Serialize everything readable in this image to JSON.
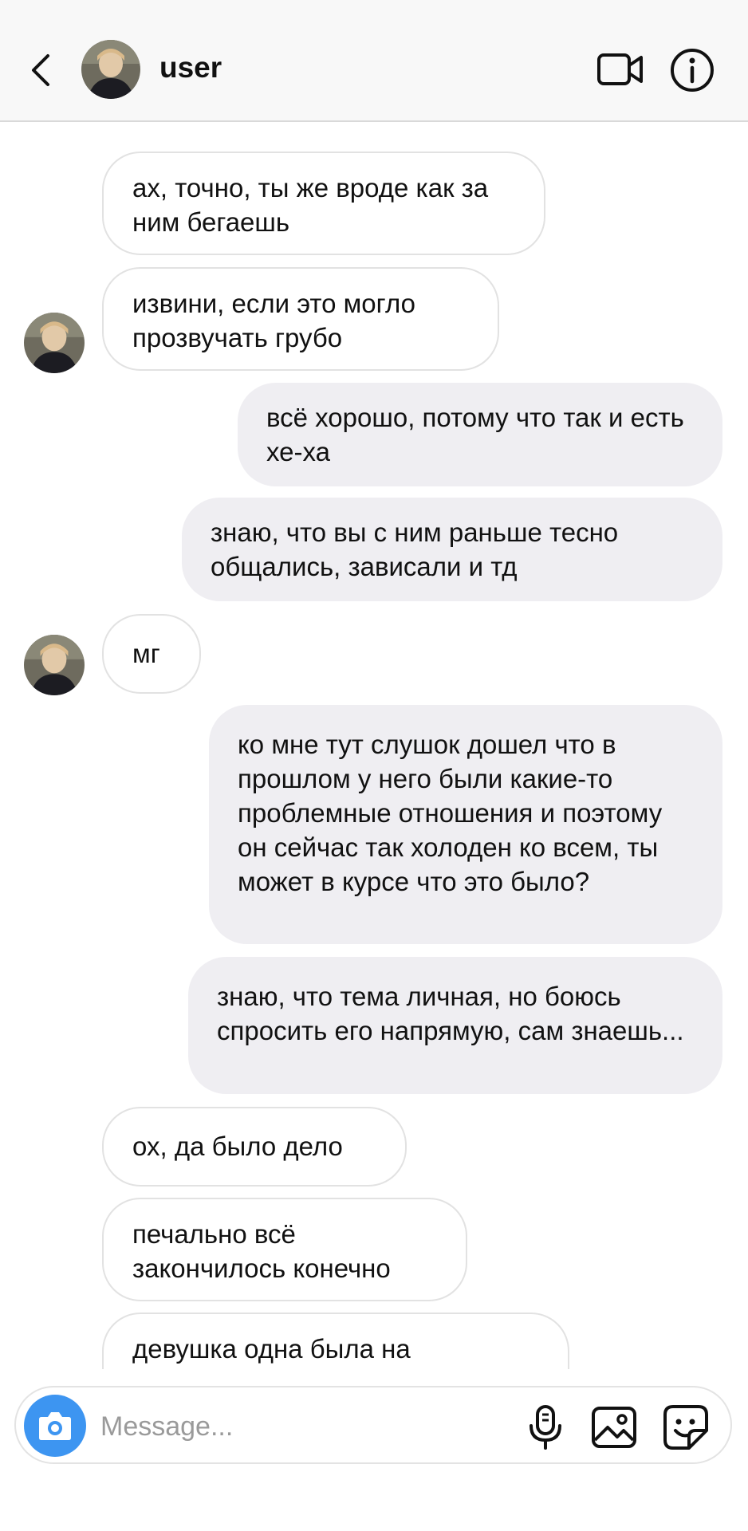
{
  "header": {
    "title": "user",
    "icons": [
      "chevron-left-icon",
      "avatar",
      "video-camera-icon",
      "info-icon"
    ]
  },
  "messages": [
    {
      "side": "in",
      "text": "ах, точно, ты же вроде как за ним бегаешь"
    },
    {
      "side": "in",
      "text": "извини, если это могло прозвучать грубо",
      "avatar": true
    },
    {
      "side": "out",
      "text": "всё хорошо, потому что так и есть хе-ха"
    },
    {
      "side": "out",
      "text": "знаю, что вы с ним раньше тесно общались, зависали и тд"
    },
    {
      "side": "in",
      "text": "мг",
      "avatar": true
    },
    {
      "side": "out",
      "text": "ко мне тут слушок дошел что в прошлом у него были какие-то проблемные отношения и поэтому он сейчас так холоден ко всем, ты может в курсе что это было?"
    },
    {
      "side": "out",
      "text": "знаю, что тема личная, но боюсь спросить его напрямую, сам знаешь..."
    },
    {
      "side": "in",
      "text": "ох, да было дело"
    },
    {
      "side": "in",
      "text": "печально всё закончилось конечно"
    },
    {
      "side": "in",
      "text": "девушка одна была на"
    }
  ],
  "composer": {
    "placeholder": "Message...",
    "value": "",
    "icons": [
      "camera-icon",
      "microphone-icon",
      "gallery-icon",
      "sticker-icon"
    ]
  },
  "colors": {
    "outgoing_bubble": "#efeef2",
    "incoming_border": "#e2e2e2",
    "camera_button": "#3d95f1",
    "header_bg": "#f8f8f8"
  }
}
